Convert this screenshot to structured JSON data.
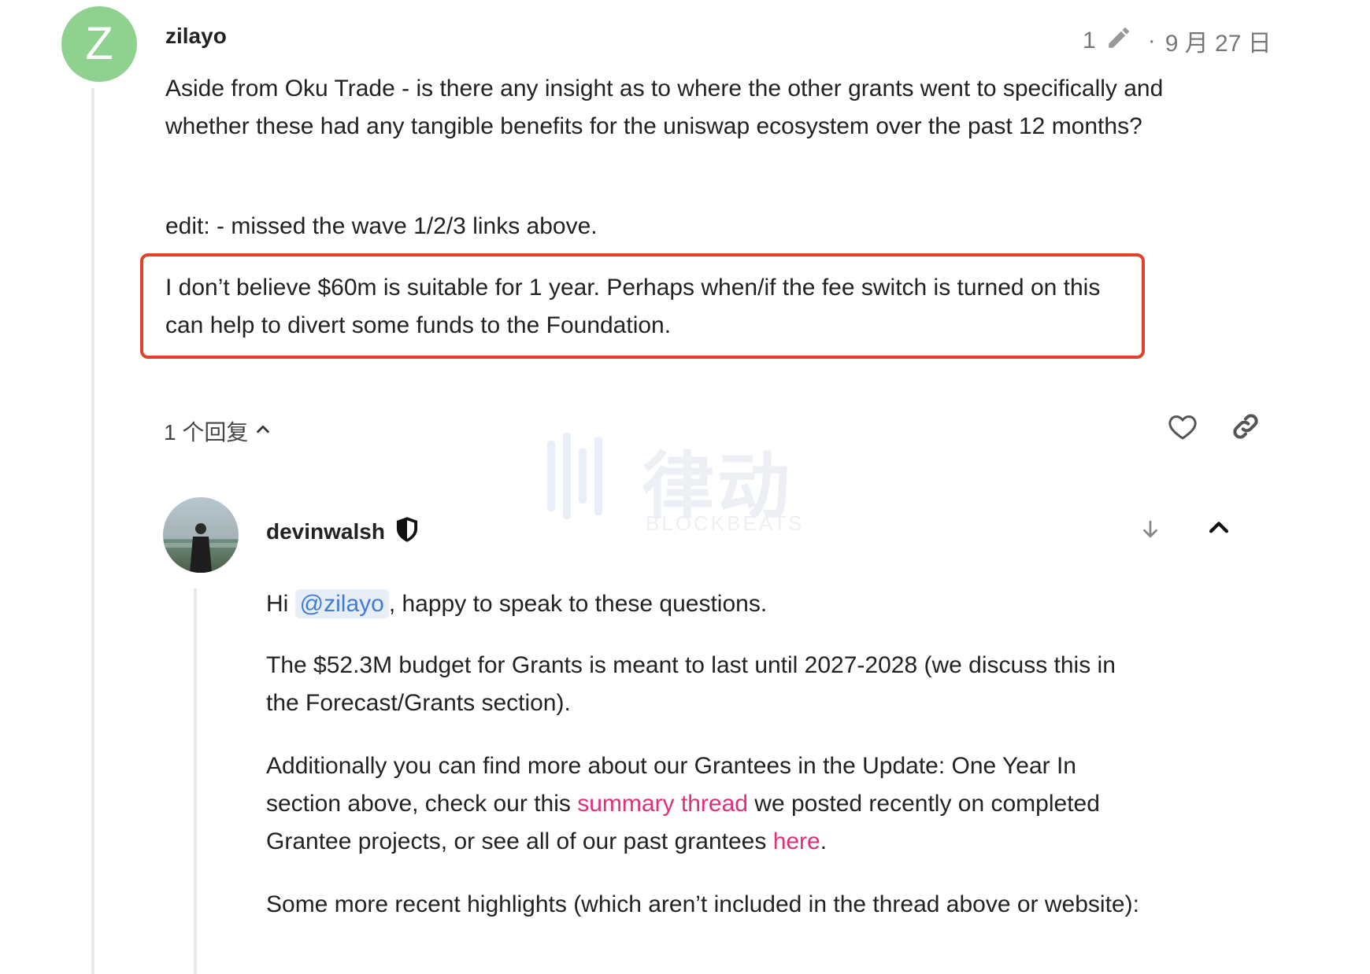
{
  "post1": {
    "avatar_letter": "Z",
    "username": "zilayo",
    "edit_count": "1",
    "date": "9 月 27 日",
    "paragraphs": [
      "Aside from Oku Trade - is there any insight as to where the other grants went to specifically and whether these had any tangible benefits for the uniswap ecosystem over the past 12 months?",
      "edit: - missed the wave 1/2/3 links above.",
      "I don’t believe $60m is suitable for 1 year. Perhaps when/if the fee switch is turned on this can help to divert some funds to the Foundation."
    ],
    "replies_label": "1 个回复"
  },
  "post2": {
    "username": "devinwalsh",
    "p1_prefix": "Hi ",
    "mention": "@zilayo",
    "p1_suffix": ", happy to speak to these questions.",
    "p2": "The $52.3M budget for Grants is meant to last until 2027-2028 (we discuss this in the Forecast/Grants section).",
    "p3_a": "Additionally you can find more about our Grantees in the Update: One Year In section above, check our this ",
    "p3_link1": "summary thread",
    "p3_b": " we posted recently on completed Grantee projects, or see all of our past grantees ",
    "p3_link2": "here",
    "p3_c": ".",
    "p4": "Some more recent highlights (which aren’t included in the thread above or website):"
  },
  "watermark": {
    "main": "律动",
    "sub": "BLOCKBEATS"
  },
  "colors": {
    "highlight_border": "#e1412b",
    "link": "#e22d7a",
    "mention": "#3f7bd9",
    "avatar_z": "#8fd28f"
  }
}
